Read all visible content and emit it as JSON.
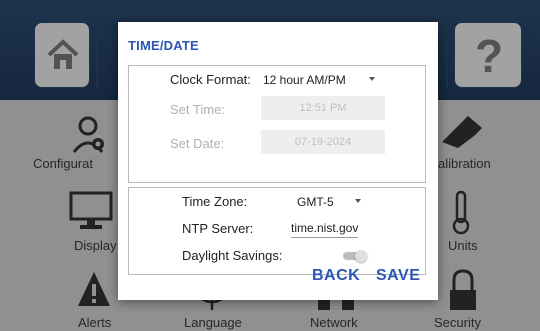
{
  "background_tiles": {
    "configure_label": "Configurat",
    "calibration_label": "alibration",
    "display_label": "Display",
    "units_label": "Units",
    "alerts_label": "Alerts",
    "language_label": "Language",
    "network_label": "Network",
    "security_label": "Security",
    "help_glyph": "?"
  },
  "dialog": {
    "title": "TIME/DATE",
    "clock_format": {
      "label": "Clock Format:",
      "value": "12 hour AM/PM"
    },
    "set_time": {
      "label": "Set Time:",
      "value": "12:51 PM"
    },
    "set_date": {
      "label": "Set Date:",
      "value": "07-19-2024"
    },
    "time_zone": {
      "label": "Time Zone:",
      "value": "GMT-5"
    },
    "ntp_server": {
      "label": "NTP Server:",
      "value": "time.nist.gov"
    },
    "daylight_savings": {
      "label": "Daylight Savings:",
      "enabled": false
    },
    "back_label": "BACK",
    "save_label": "SAVE"
  },
  "colors": {
    "accent": "#2b56b4",
    "header": "#1f3a5b"
  }
}
